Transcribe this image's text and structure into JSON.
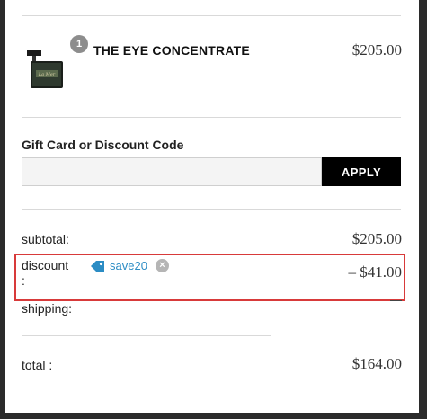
{
  "product": {
    "quantity": "1",
    "name": "THE EYE CONCENTRATE",
    "price": "$205.00"
  },
  "gift_card": {
    "label": "Gift Card or Discount Code",
    "input_value": "",
    "input_placeholder": "",
    "apply_label": "APPLY"
  },
  "summary": {
    "subtotal_label": "subtotal:",
    "subtotal_value": "$205.00",
    "discount_label": "discount",
    "discount_colon": ":",
    "discount_code": "save20",
    "discount_value": "– $41.00",
    "shipping_label": "shipping:",
    "total_label": "total :",
    "total_value": "$164.00"
  },
  "colors": {
    "accent_blue": "#2b8cc4",
    "highlight_red": "#d83a3a",
    "button_black": "#000000"
  },
  "icons": {
    "tag": "tag-icon",
    "remove": "remove-icon"
  }
}
